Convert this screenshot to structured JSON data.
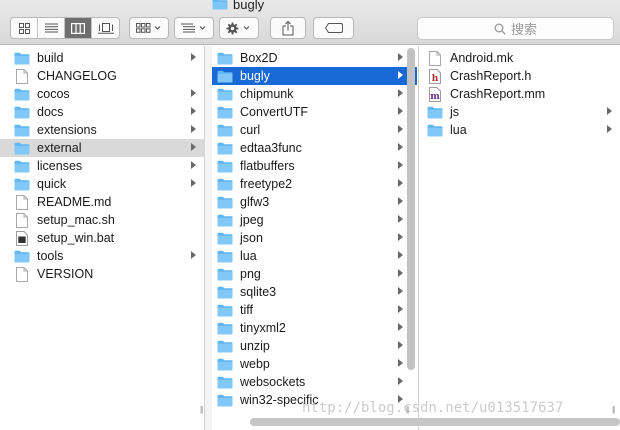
{
  "window": {
    "title": "bugly"
  },
  "toolbar": {
    "view_modes": [
      "icon-view-icon",
      "list-view-icon",
      "column-view-icon",
      "cover-flow-icon"
    ],
    "active_view": 2,
    "search_placeholder": "搜索"
  },
  "columns": {
    "col1": [
      {
        "name": "build",
        "type": "folder",
        "has_children": true
      },
      {
        "name": "CHANGELOG",
        "type": "file",
        "has_children": false
      },
      {
        "name": "cocos",
        "type": "folder",
        "has_children": true
      },
      {
        "name": "docs",
        "type": "folder",
        "has_children": true
      },
      {
        "name": "extensions",
        "type": "folder",
        "has_children": true
      },
      {
        "name": "external",
        "type": "folder",
        "has_children": true,
        "selected": "inactive"
      },
      {
        "name": "licenses",
        "type": "folder",
        "has_children": true
      },
      {
        "name": "quick",
        "type": "folder",
        "has_children": true
      },
      {
        "name": "README.md",
        "type": "file",
        "has_children": false
      },
      {
        "name": "setup_mac.sh",
        "type": "file",
        "has_children": false
      },
      {
        "name": "setup_win.bat",
        "type": "exec",
        "has_children": false
      },
      {
        "name": "tools",
        "type": "folder",
        "has_children": true
      },
      {
        "name": "VERSION",
        "type": "file",
        "has_children": false
      }
    ],
    "col2": [
      {
        "name": "Box2D",
        "type": "folder",
        "has_children": true
      },
      {
        "name": "bugly",
        "type": "folder",
        "has_children": true,
        "selected": "active"
      },
      {
        "name": "chipmunk",
        "type": "folder",
        "has_children": true
      },
      {
        "name": "ConvertUTF",
        "type": "folder",
        "has_children": true
      },
      {
        "name": "curl",
        "type": "folder",
        "has_children": true
      },
      {
        "name": "edtaa3func",
        "type": "folder",
        "has_children": true
      },
      {
        "name": "flatbuffers",
        "type": "folder",
        "has_children": true
      },
      {
        "name": "freetype2",
        "type": "folder",
        "has_children": true
      },
      {
        "name": "glfw3",
        "type": "folder",
        "has_children": true
      },
      {
        "name": "jpeg",
        "type": "folder",
        "has_children": true
      },
      {
        "name": "json",
        "type": "folder",
        "has_children": true
      },
      {
        "name": "lua",
        "type": "folder",
        "has_children": true
      },
      {
        "name": "png",
        "type": "folder",
        "has_children": true
      },
      {
        "name": "sqlite3",
        "type": "folder",
        "has_children": true
      },
      {
        "name": "tiff",
        "type": "folder",
        "has_children": true
      },
      {
        "name": "tinyxml2",
        "type": "folder",
        "has_children": true
      },
      {
        "name": "unzip",
        "type": "folder",
        "has_children": true
      },
      {
        "name": "webp",
        "type": "folder",
        "has_children": true
      },
      {
        "name": "websockets",
        "type": "folder",
        "has_children": true
      },
      {
        "name": "win32-specific",
        "type": "folder",
        "has_children": true
      }
    ],
    "col3": [
      {
        "name": "Android.mk",
        "type": "file",
        "has_children": false
      },
      {
        "name": "CrashReport.h",
        "type": "header",
        "has_children": false
      },
      {
        "name": "CrashReport.mm",
        "type": "mm",
        "has_children": false
      },
      {
        "name": "js",
        "type": "folder",
        "has_children": true
      },
      {
        "name": "lua",
        "type": "folder",
        "has_children": true
      }
    ]
  },
  "watermark": "http://blog.csdn.net/u013517637",
  "colors": {
    "folder": "#5fb6f0",
    "selection": "#1868d6",
    "inactive_selection": "#d9d9d9"
  }
}
